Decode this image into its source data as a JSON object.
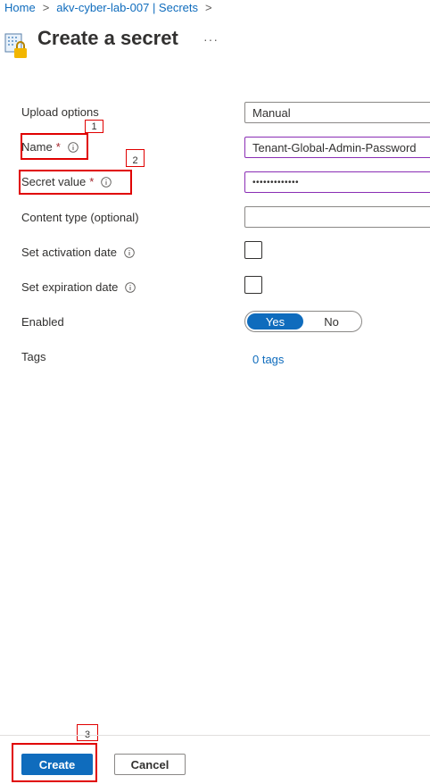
{
  "breadcrumb": {
    "items": [
      "Home",
      "akv-cyber-lab-007 | Secrets"
    ],
    "separator": ">"
  },
  "header": {
    "title": "Create a secret",
    "more_label": "···",
    "icon": "key-vault-secret-icon"
  },
  "form": {
    "upload_options": {
      "label": "Upload options",
      "value": "Manual"
    },
    "name": {
      "label": "Name",
      "required_mark": "*",
      "value": "Tenant-Global-Admin-Password"
    },
    "secret_value": {
      "label": "Secret value",
      "required_mark": "*",
      "value": "•••••••••••••"
    },
    "content_type": {
      "label": "Content type (optional)",
      "value": ""
    },
    "activation_date": {
      "label": "Set activation date",
      "checked": false
    },
    "expiration_date": {
      "label": "Set expiration date",
      "checked": false
    },
    "enabled": {
      "label": "Enabled",
      "yes": "Yes",
      "no": "No",
      "selected": "Yes"
    },
    "tags": {
      "label": "Tags",
      "link": "0 tags"
    }
  },
  "annotations": [
    "1",
    "2",
    "3"
  ],
  "footer": {
    "create_label": "Create",
    "cancel_label": "Cancel"
  },
  "colors": {
    "accent": "#0f6cbd",
    "annotation": "#e00000",
    "active_input_border": "#8a2eb5",
    "required": "#a4262c"
  }
}
